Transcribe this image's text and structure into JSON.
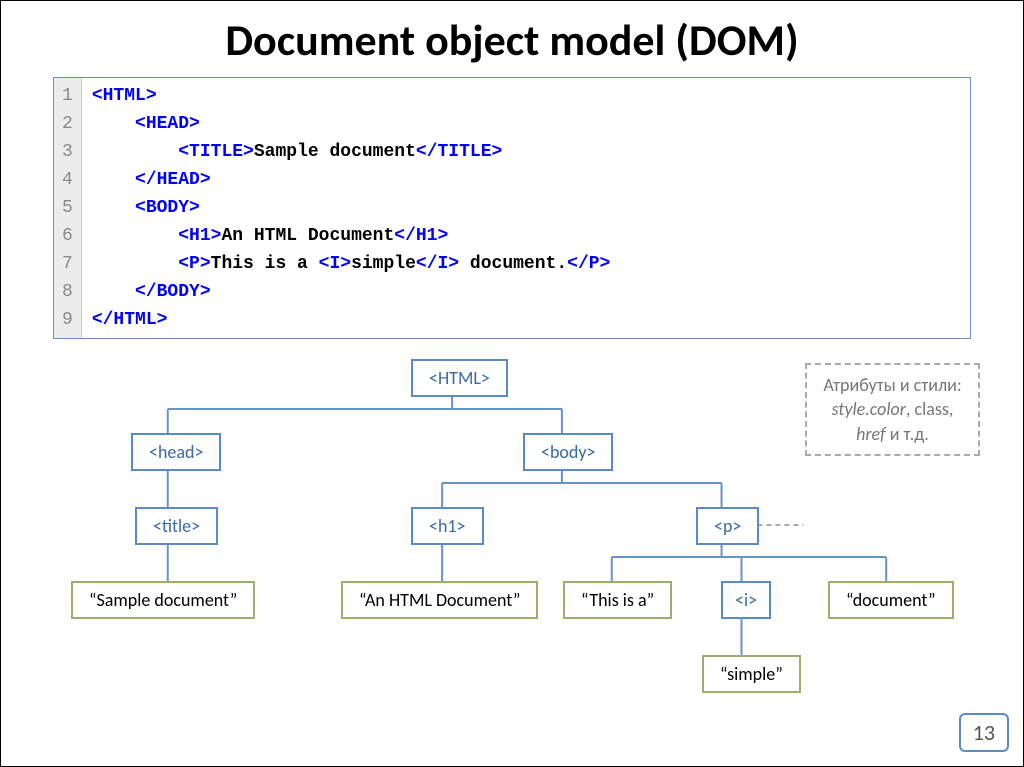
{
  "title": "Document object model (DOM)",
  "code": {
    "line_numbers": [
      "1",
      "2",
      "3",
      "4",
      "5",
      "6",
      "7",
      "8",
      "9"
    ],
    "lines": [
      [
        {
          "cls": "tag",
          "t": "<HTML>"
        }
      ],
      [
        {
          "cls": "tag",
          "t": "<HEAD>"
        }
      ],
      [
        {
          "cls": "tag",
          "t": "<TITLE>"
        },
        {
          "cls": "txt",
          "t": "Sample document"
        },
        {
          "cls": "tag",
          "t": "</TITLE>"
        }
      ],
      [
        {
          "cls": "tag",
          "t": "</HEAD>"
        }
      ],
      [
        {
          "cls": "tag",
          "t": "<BODY>"
        }
      ],
      [
        {
          "cls": "tag",
          "t": "<H1>"
        },
        {
          "cls": "txt",
          "t": "An HTML Document"
        },
        {
          "cls": "tag",
          "t": "</H1>"
        }
      ],
      [
        {
          "cls": "tag",
          "t": "<P>"
        },
        {
          "cls": "txt",
          "t": "This is a "
        },
        {
          "cls": "tag",
          "t": "<I>"
        },
        {
          "cls": "txt",
          "t": "simple"
        },
        {
          "cls": "tag",
          "t": "</I>"
        },
        {
          "cls": "txt",
          "t": " document."
        },
        {
          "cls": "tag",
          "t": "</P>"
        }
      ],
      [
        {
          "cls": "tag",
          "t": "</BODY>"
        }
      ],
      [
        {
          "cls": "tag",
          "t": "</HTML>"
        }
      ]
    ],
    "indent": [
      0,
      1,
      2,
      1,
      1,
      2,
      2,
      1,
      0
    ]
  },
  "tree": {
    "html": "<HTML>",
    "head": "<head>",
    "body": "<body>",
    "title": "<title>",
    "h1": "<h1>",
    "p": "<p>",
    "i": "<i>",
    "leaf_sample": "“Sample document”",
    "leaf_anhtml": "“An HTML Document”",
    "leaf_thisis": "“This is a”",
    "leaf_document": "“document”",
    "leaf_simple": "“simple”"
  },
  "note": {
    "line1": "Атрибуты и стили:",
    "line2a": "style.color",
    "line2b": ", class,",
    "line3a": "href",
    "line3b": " и т.д."
  },
  "page_number": "13"
}
